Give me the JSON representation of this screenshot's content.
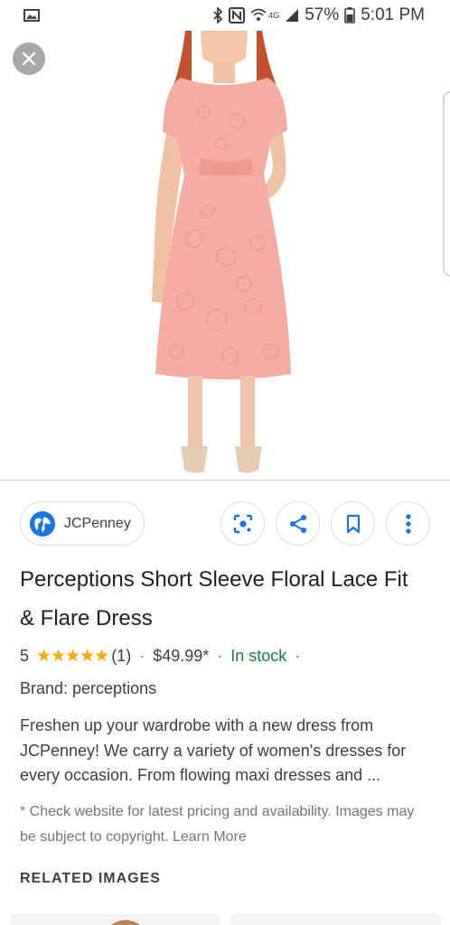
{
  "status_bar": {
    "network": "4G",
    "battery": "57%",
    "time": "5:01 PM"
  },
  "image_viewer": {
    "close_icon": "close-icon",
    "image_subject": "dress-image"
  },
  "source": {
    "label": "JCPenney",
    "icon": "globe-icon"
  },
  "actions": [
    {
      "name": "lens",
      "icon": "lens-icon"
    },
    {
      "name": "share",
      "icon": "share-icon"
    },
    {
      "name": "save",
      "icon": "bookmark-icon"
    },
    {
      "name": "more",
      "icon": "more-vert-icon"
    }
  ],
  "product": {
    "title": "Perceptions Short Sleeve Floral Lace Fit & Flare Dress",
    "rating": "5",
    "stars": "★★★★★",
    "review_count": "(1)",
    "price": "$49.99*",
    "availability": "In stock",
    "brand": "Brand: perceptions",
    "description": "Freshen up your wardrobe with a new dress from JCPenney! We carry a variety of women's dresses for every occasion. From flowing maxi dresses and ...",
    "disclaimer": "* Check website for latest pricing and availability. Images may be subject to copyright. Learn More"
  },
  "related": {
    "heading": "RELATED IMAGES"
  },
  "colors": {
    "accent": "#1a73e8",
    "in_stock": "#188038",
    "star": "#f9ab00",
    "dress": "#f4aca0"
  }
}
